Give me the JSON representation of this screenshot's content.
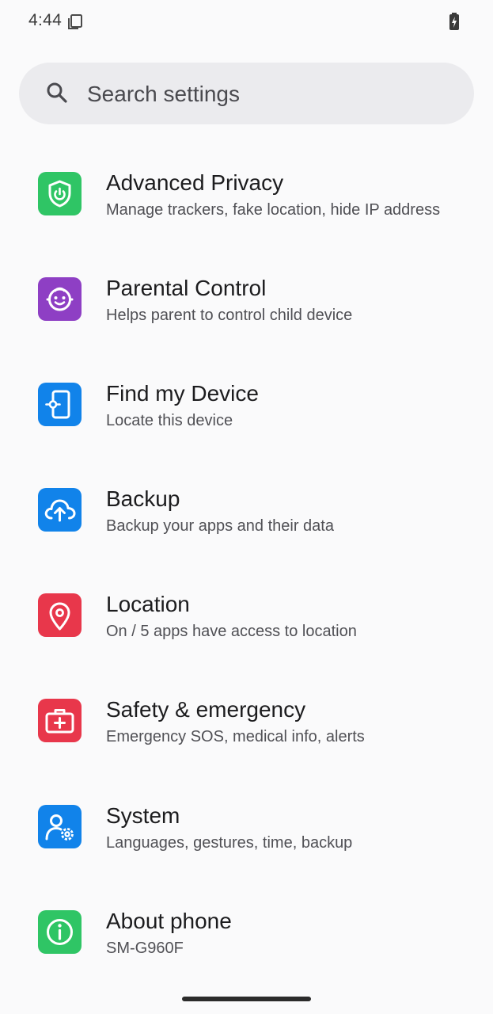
{
  "status_bar": {
    "time": "4:44"
  },
  "search": {
    "placeholder": "Search settings"
  },
  "colors": {
    "advanced_privacy": "#2fc565",
    "parental_control": "#8e3fc4",
    "find_my_device": "#1183ea",
    "backup": "#1183ea",
    "location": "#e8374b",
    "safety": "#e8374b",
    "system": "#1183ea",
    "about": "#2fc565"
  },
  "items": [
    {
      "title": "Advanced Privacy",
      "subtitle": "Manage trackers, fake location, hide IP address",
      "icon": "shield-power-icon"
    },
    {
      "title": "Parental Control",
      "subtitle": "Helps parent to control child device",
      "icon": "child-face-icon"
    },
    {
      "title": "Find my Device",
      "subtitle": "Locate this device",
      "icon": "phone-locate-icon"
    },
    {
      "title": "Backup",
      "subtitle": "Backup your apps and their data",
      "icon": "cloud-upload-icon"
    },
    {
      "title": "Location",
      "subtitle": "On / 5 apps have access to location",
      "icon": "location-pin-icon"
    },
    {
      "title": "Safety & emergency",
      "subtitle": "Emergency SOS, medical info, alerts",
      "icon": "medical-kit-icon"
    },
    {
      "title": "System",
      "subtitle": "Languages, gestures, time, backup",
      "icon": "user-gear-icon"
    },
    {
      "title": "About phone",
      "subtitle": "SM-G960F",
      "icon": "info-icon"
    }
  ]
}
